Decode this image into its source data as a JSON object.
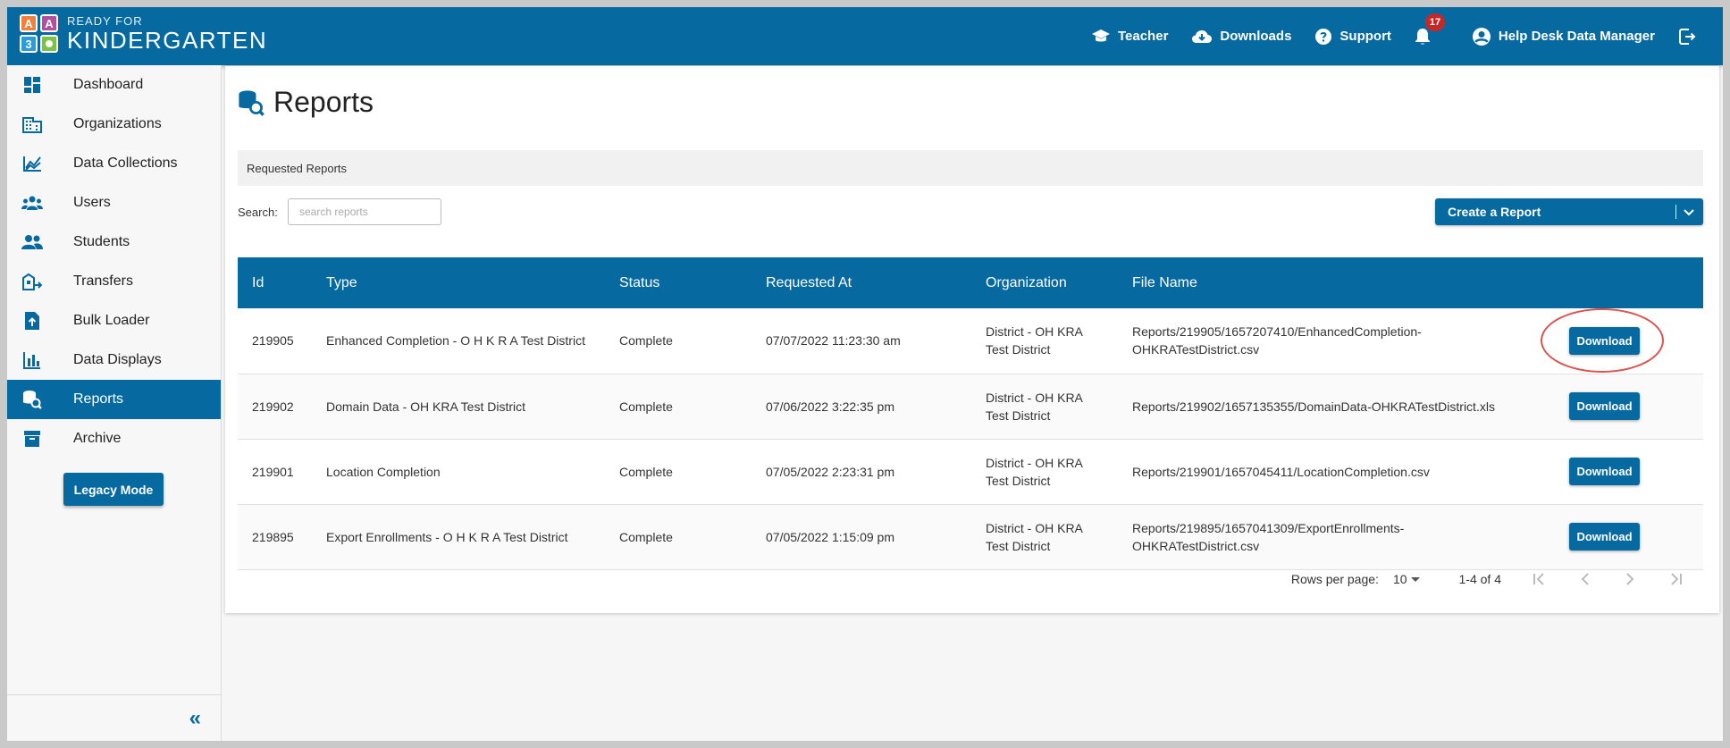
{
  "header": {
    "logo_small": "READY FOR",
    "logo_big": "KINDERGARTEN",
    "logo_tiles": [
      "A",
      "A",
      "3",
      ""
    ],
    "nav": {
      "teacher": "Teacher",
      "downloads": "Downloads",
      "support": "Support",
      "notifications_count": "17",
      "user": "Help Desk Data Manager"
    }
  },
  "sidebar": {
    "items": [
      {
        "label": "Dashboard",
        "icon": "dashboard-icon"
      },
      {
        "label": "Organizations",
        "icon": "building-icon"
      },
      {
        "label": "Data Collections",
        "icon": "chart-line-icon"
      },
      {
        "label": "Users",
        "icon": "users-icon"
      },
      {
        "label": "Students",
        "icon": "students-icon"
      },
      {
        "label": "Transfers",
        "icon": "transfer-icon"
      },
      {
        "label": "Bulk Loader",
        "icon": "upload-file-icon"
      },
      {
        "label": "Data Displays",
        "icon": "bar-chart-icon"
      },
      {
        "label": "Reports",
        "icon": "reports-icon"
      },
      {
        "label": "Archive",
        "icon": "archive-icon"
      }
    ],
    "active": "Reports",
    "legacy_label": "Legacy Mode",
    "collapse_glyph": "«"
  },
  "main": {
    "title": "Reports",
    "subbar": "Requested Reports",
    "search_label": "Search:",
    "search_placeholder": "search reports",
    "create_label": "Create a Report",
    "table": {
      "columns": [
        "Id",
        "Type",
        "Status",
        "Requested At",
        "Organization",
        "File Name",
        ""
      ],
      "rows": [
        {
          "id": "219905",
          "type": "Enhanced Completion - O H K R A Test District",
          "status": "Complete",
          "requested_at": "07/07/2022 11:23:30 am",
          "org_1": "District - OH KRA",
          "org_2": "Test District",
          "file_1": "Reports/219905/1657207410/EnhancedCompletion-",
          "file_2": "OHKRATestDistrict.csv",
          "action": "Download"
        },
        {
          "id": "219902",
          "type": "Domain Data - OH KRA Test District",
          "status": "Complete",
          "requested_at": "07/06/2022 3:22:35 pm",
          "org_1": "District - OH KRA",
          "org_2": "Test District",
          "file_1": "Reports/219902/1657135355/DomainData-OHKRATestDistrict.xls",
          "file_2": "",
          "action": "Download"
        },
        {
          "id": "219901",
          "type": "Location Completion",
          "status": "Complete",
          "requested_at": "07/05/2022 2:23:31 pm",
          "org_1": "District - OH KRA",
          "org_2": "Test District",
          "file_1": "Reports/219901/1657045411/LocationCompletion.csv",
          "file_2": "",
          "action": "Download"
        },
        {
          "id": "219895",
          "type": "Export Enrollments - O H K R A Test District",
          "status": "Complete",
          "requested_at": "07/05/2022 1:15:09 pm",
          "org_1": "District - OH KRA",
          "org_2": "Test District",
          "file_1": "Reports/219895/1657041309/ExportEnrollments-",
          "file_2": "OHKRATestDistrict.csv",
          "action": "Download"
        }
      ]
    },
    "pager": {
      "rows_per_page_label": "Rows per page:",
      "rows_per_page_value": "10",
      "range": "1-4 of 4"
    }
  },
  "colors": {
    "primary": "#06699f",
    "highlight": "#d9534f",
    "badge": "#c62828"
  }
}
